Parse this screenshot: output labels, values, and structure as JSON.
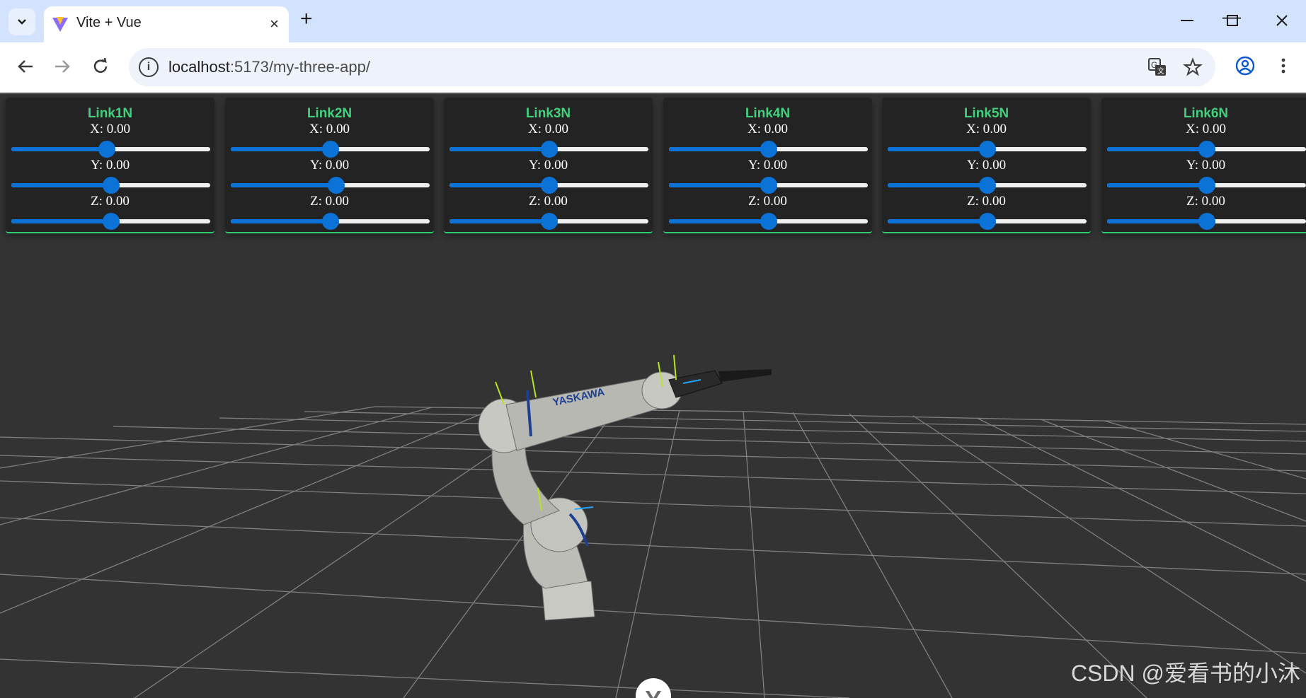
{
  "browser": {
    "tab_title": "Vite + Vue",
    "url_host": "localhost",
    "url_rest": ":5173/my-three-app/",
    "new_tab": "+",
    "close": "×",
    "minimize": "—",
    "maximize": "☐",
    "window_close": "✕"
  },
  "panels": [
    {
      "title": "Link1N",
      "x": "X: 0.00",
      "y": "Y: 0.00",
      "z": "Z: 0.00",
      "xv": 0.48,
      "yv": 0.5,
      "zv": 0.5
    },
    {
      "title": "Link2N",
      "x": "X: 0.00",
      "y": "Y: 0.00",
      "z": "Z: 0.00",
      "xv": 0.5,
      "yv": 0.53,
      "zv": 0.5
    },
    {
      "title": "Link3N",
      "x": "X: 0.00",
      "y": "Y: 0.00",
      "z": "Z: 0.00",
      "xv": 0.5,
      "yv": 0.5,
      "zv": 0.5
    },
    {
      "title": "Link4N",
      "x": "X: 0.00",
      "y": "Y: 0.00",
      "z": "Z: 0.00",
      "xv": 0.5,
      "yv": 0.5,
      "zv": 0.5
    },
    {
      "title": "Link5N",
      "x": "X: 0.00",
      "y": "Y: 0.00",
      "z": "Z: 0.00",
      "xv": 0.5,
      "yv": 0.5,
      "zv": 0.5
    },
    {
      "title": "Link6N",
      "x": "X: 0.00",
      "y": "Y: 0.00",
      "z": "Z: 0.00",
      "xv": 0.5,
      "yv": 0.5,
      "zv": 0.5
    }
  ],
  "robot_label": "YASKAWA",
  "watermark": "CSDN @爱看书的小沐",
  "colors": {
    "accent": "#42d07f",
    "slider": "#0b73d8",
    "background": "#333333",
    "grid": "#9a9a9a"
  }
}
